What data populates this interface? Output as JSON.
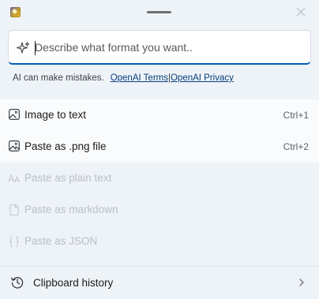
{
  "prompt": {
    "placeholder": "Describe what format you want.."
  },
  "disclaimer": {
    "text": "AI can make mistakes.",
    "terms_link": "OpenAI Terms",
    "separator": "|",
    "privacy_link": "OpenAI Privacy"
  },
  "actions": [
    {
      "label": "Image to text",
      "shortcut": "Ctrl+1",
      "icon": "image-icon"
    },
    {
      "label": "Paste as .png file",
      "shortcut": "Ctrl+2",
      "icon": "image-file-icon"
    }
  ],
  "disabled_actions": [
    {
      "label": "Paste as plain text",
      "icon": "text-aa-icon"
    },
    {
      "label": "Paste as markdown",
      "icon": "document-icon"
    },
    {
      "label": "Paste as JSON",
      "icon": "json-braces-icon"
    }
  ],
  "footer": {
    "history_label": "Clipboard history",
    "history_icon": "history-clock-icon"
  },
  "colors": {
    "background": "#eef3f8",
    "accent": "#005fb8",
    "link": "#063d7a",
    "disabled_text": "#b9bfc6"
  }
}
